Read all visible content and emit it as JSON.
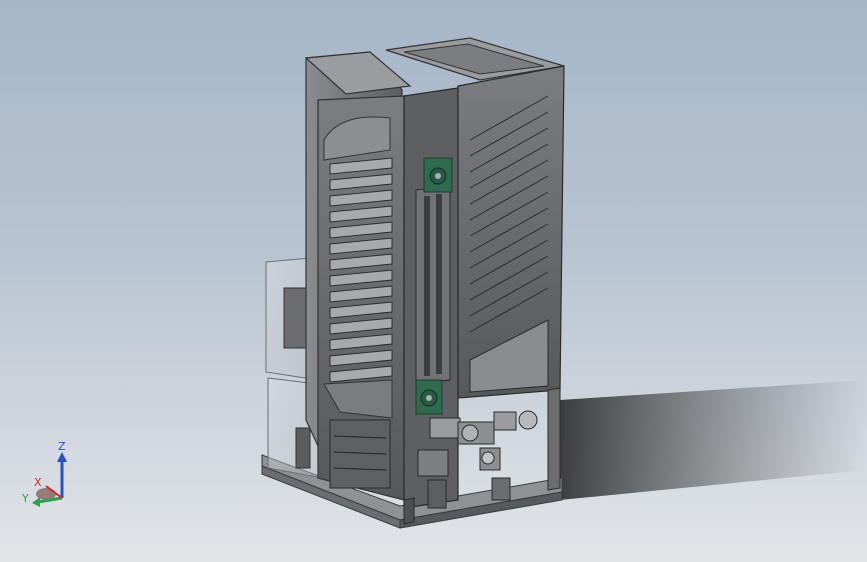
{
  "viewport": {
    "background_top": "#a6b6c8",
    "background_bottom": "#e2e5e8"
  },
  "model": {
    "frame_color": "#4a4a4a",
    "panel_color": "#6d6f72",
    "bearing_color": "#2f6b4f"
  },
  "triad": {
    "x_label": "X",
    "y_label": "Y",
    "z_label": "Z",
    "x_color": "#cc2a2a",
    "y_color": "#2aa24a",
    "z_color": "#2a4fcc"
  }
}
